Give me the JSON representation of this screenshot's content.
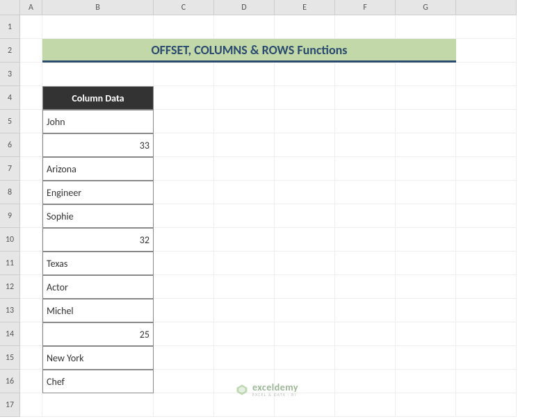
{
  "columns": [
    "A",
    "B",
    "C",
    "D",
    "E",
    "F",
    "G"
  ],
  "rows": [
    "1",
    "2",
    "3",
    "4",
    "5",
    "6",
    "7",
    "8",
    "9",
    "10",
    "11",
    "12",
    "13",
    "14",
    "15",
    "16",
    "17"
  ],
  "title": "OFFSET, COLUMNS & ROWS Functions",
  "table": {
    "header": "Column Data",
    "cells": [
      {
        "v": "John",
        "t": "txt"
      },
      {
        "v": "33",
        "t": "num"
      },
      {
        "v": "Arizona",
        "t": "txt"
      },
      {
        "v": "Engineer",
        "t": "txt"
      },
      {
        "v": "Sophie",
        "t": "txt"
      },
      {
        "v": "32",
        "t": "num"
      },
      {
        "v": "Texas",
        "t": "txt"
      },
      {
        "v": "Actor",
        "t": "txt"
      },
      {
        "v": "Michel",
        "t": "txt"
      },
      {
        "v": "25",
        "t": "num"
      },
      {
        "v": "New York",
        "t": "txt"
      },
      {
        "v": "Chef",
        "t": "txt"
      }
    ]
  },
  "watermark": {
    "main": "exceldemy",
    "sub": "EXCEL & DATA · BI"
  },
  "chart_data": {
    "type": "table",
    "title": "OFFSET, COLUMNS & ROWS Functions",
    "columns": [
      "Column Data"
    ],
    "rows": [
      [
        "John"
      ],
      [
        33
      ],
      [
        "Arizona"
      ],
      [
        "Engineer"
      ],
      [
        "Sophie"
      ],
      [
        32
      ],
      [
        "Texas"
      ],
      [
        "Actor"
      ],
      [
        "Michel"
      ],
      [
        25
      ],
      [
        "New York"
      ],
      [
        "Chef"
      ]
    ]
  }
}
